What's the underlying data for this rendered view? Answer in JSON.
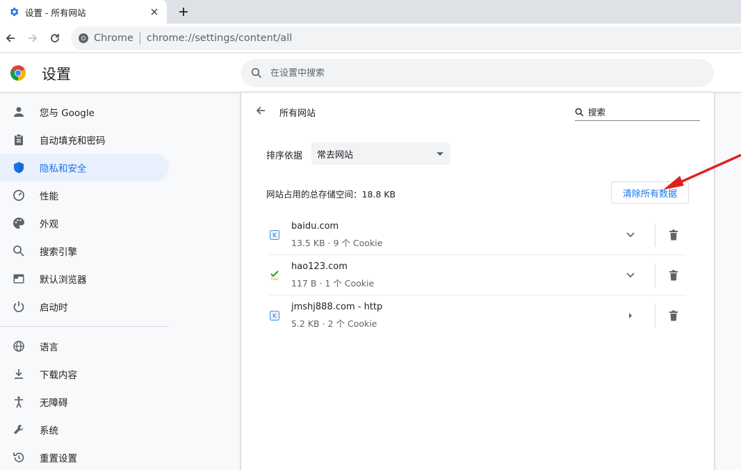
{
  "tab": {
    "title": "设置 - 所有网站"
  },
  "toolbar": {
    "omnibox_label": "Chrome",
    "url": "chrome://settings/content/all"
  },
  "header": {
    "title": "设置",
    "search_placeholder": "在设置中搜索"
  },
  "sidebar": {
    "items": [
      {
        "label": "您与 Google",
        "icon": "person-icon"
      },
      {
        "label": "自动填充和密码",
        "icon": "clipboard-icon"
      },
      {
        "label": "隐私和安全",
        "icon": "shield-icon",
        "active": true
      },
      {
        "label": "性能",
        "icon": "gauge-icon"
      },
      {
        "label": "外观",
        "icon": "palette-icon"
      },
      {
        "label": "搜索引擎",
        "icon": "search-icon"
      },
      {
        "label": "默认浏览器",
        "icon": "browser-icon"
      },
      {
        "label": "启动时",
        "icon": "power-icon"
      },
      {
        "label": "语言",
        "icon": "globe-icon"
      },
      {
        "label": "下载内容",
        "icon": "download-icon"
      },
      {
        "label": "无障碍",
        "icon": "accessibility-icon"
      },
      {
        "label": "系统",
        "icon": "wrench-icon"
      },
      {
        "label": "重置设置",
        "icon": "reset-icon"
      }
    ]
  },
  "main": {
    "title": "所有网站",
    "search_placeholder": "搜索",
    "sort_label": "排序依据",
    "sort_value": "常去网站",
    "storage_text": "网站占用的总存储空间：18.8 KB",
    "clear_button": "清除所有数据",
    "sites": [
      {
        "name": "baidu.com",
        "meta": "13.5 KB · 9 个 Cookie",
        "expand": "chevron-down-icon"
      },
      {
        "name": "hao123.com",
        "meta": "117 B · 1 个 Cookie",
        "expand": "chevron-down-icon"
      },
      {
        "name": "jmshj888.com - http",
        "meta": "5.2 KB · 2 个 Cookie",
        "expand": "arrow-right-icon"
      }
    ]
  },
  "colors": {
    "accent": "#1a73e8",
    "active_bg": "#e8f0fe",
    "annotation_arrow": "#e02020"
  }
}
